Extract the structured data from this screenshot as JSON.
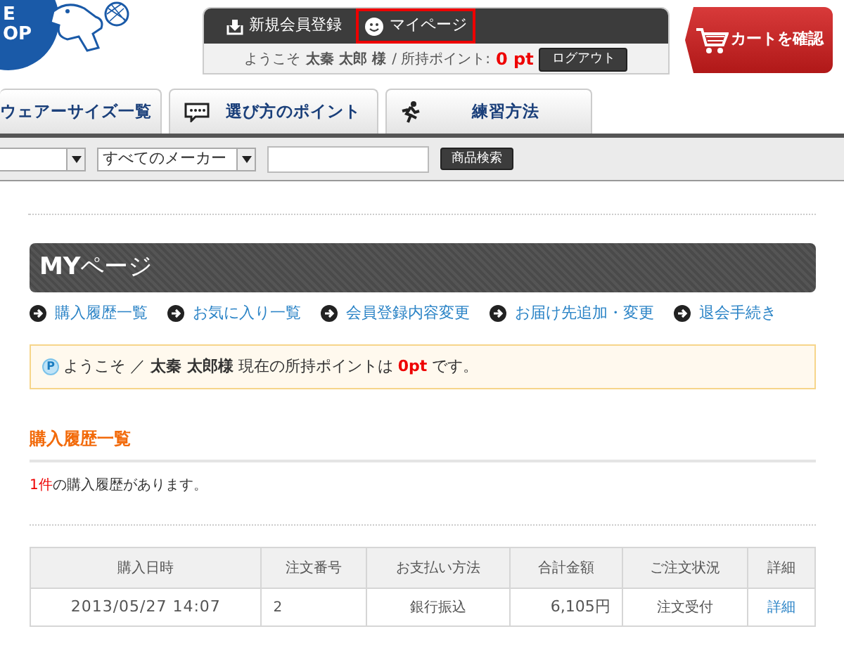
{
  "logo": {
    "lines": [
      "E",
      "OP"
    ]
  },
  "top_links": [
    {
      "label": "新規会員登録",
      "kind": "download",
      "selected": false
    },
    {
      "label": "マイページ",
      "kind": "smile",
      "selected": true
    }
  ],
  "user_bar": {
    "welcome": "ようこそ",
    "user": "太秦 太郎 様",
    "points_label": "/ 所持ポイント:",
    "points": "0 pt",
    "logout": "ログアウト"
  },
  "cart_button": "カートを確認",
  "tabs": [
    {
      "label": "ウェアーサイズ一覧",
      "kind": "plain"
    },
    {
      "label": "選び方のポイント",
      "kind": "chat"
    },
    {
      "label": "練習方法",
      "kind": "run"
    }
  ],
  "search": {
    "maker_select": "すべてのメーカー",
    "button": "商品検索"
  },
  "page_title": "**MY**ページ",
  "nav_links": [
    "購入履歴一覧",
    "お気に入り一覧",
    "会員登録内容変更",
    "お届け先追加・変更",
    "退会手続き"
  ],
  "notice": {
    "badge": "P",
    "prefix": "ようこそ ／",
    "name": "太秦 太郎様",
    "middle": "現在の所持ポイントは",
    "points": "0pt",
    "suffix": "です。"
  },
  "history": {
    "title": "購入履歴一覧",
    "count": "1件",
    "count_suffix": "の購入履歴があります。",
    "columns": [
      "購入日時",
      "注文番号",
      "お支払い方法",
      "合計金額",
      "ご注文状況",
      "詳細"
    ],
    "rows": [
      [
        "2013/05/27 14:07",
        "2",
        "銀行振込",
        "6,105円",
        "注文受付",
        "詳細"
      ]
    ]
  }
}
